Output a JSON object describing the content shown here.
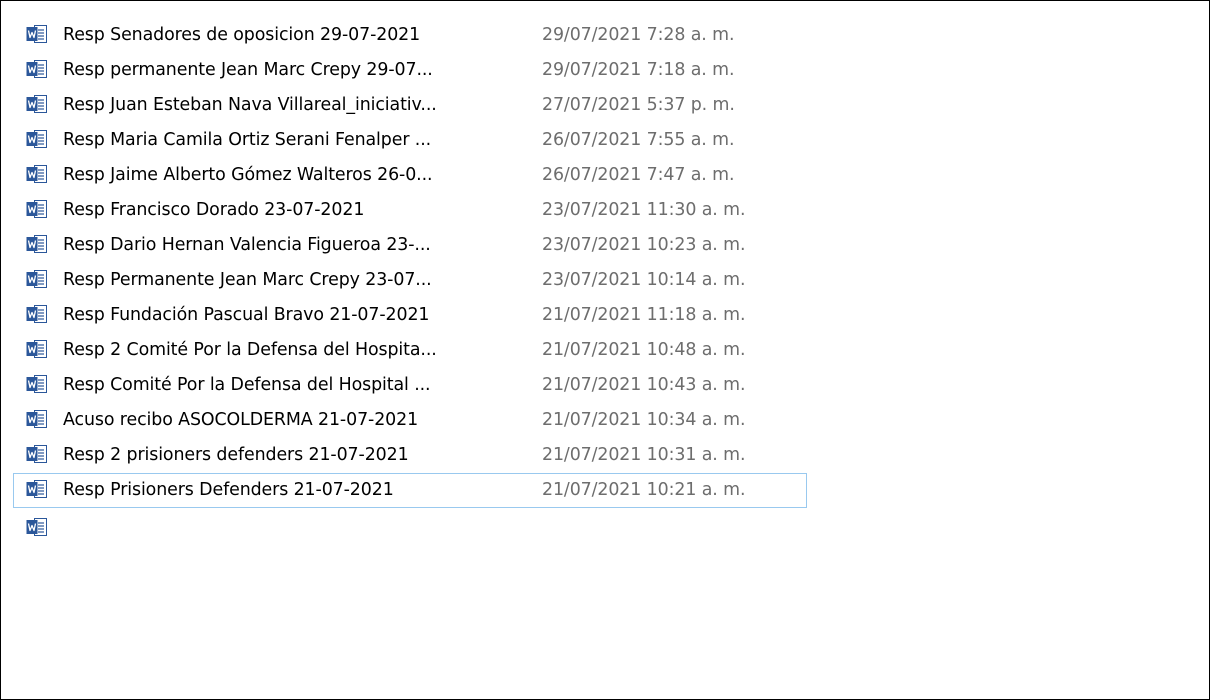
{
  "colors": {
    "filename_text": "#000000",
    "date_text": "#6d6d6d",
    "focus_border": "#99c9ef",
    "word_icon_blue": "#2b579a"
  },
  "file_icon": "word-document-icon",
  "files": [
    {
      "name": "Resp Senadores de oposicion 29-07-2021",
      "modified": "29/07/2021 7:28 a. m."
    },
    {
      "name": "Resp permanente  Jean Marc Crepy 29-07...",
      "modified": "29/07/2021 7:18 a. m."
    },
    {
      "name": "Resp Juan Esteban Nava Villareal_iniciativ...",
      "modified": "27/07/2021 5:37 p. m."
    },
    {
      "name": "Resp Maria Camila Ortiz Serani Fenalper ...",
      "modified": "26/07/2021 7:55 a. m."
    },
    {
      "name": "Resp Jaime Alberto Gómez Walteros 26-0...",
      "modified": "26/07/2021 7:47 a. m."
    },
    {
      "name": "Resp Francisco Dorado 23-07-2021",
      "modified": "23/07/2021 11:30 a. m."
    },
    {
      "name": "Resp Dario Hernan Valencia Figueroa 23-...",
      "modified": "23/07/2021 10:23 a. m."
    },
    {
      "name": "Resp Permanente  Jean Marc Crepy 23-07...",
      "modified": "23/07/2021 10:14 a. m."
    },
    {
      "name": "Resp Fundación Pascual Bravo 21-07-2021",
      "modified": "21/07/2021 11:18 a. m."
    },
    {
      "name": "Resp 2 Comité Por la Defensa del Hospita...",
      "modified": "21/07/2021 10:48 a. m."
    },
    {
      "name": "Resp Comité Por la Defensa del Hospital ...",
      "modified": "21/07/2021 10:43 a. m."
    },
    {
      "name": "Acuso recibo ASOCOLDERMA 21-07-2021",
      "modified": "21/07/2021 10:34 a. m."
    },
    {
      "name": "Resp 2 prisioners defenders 21-07-2021",
      "modified": "21/07/2021 10:31 a. m."
    },
    {
      "name": "Resp Prisioners Defenders 21-07-2021",
      "modified": "21/07/2021 10:21 a. m."
    }
  ]
}
